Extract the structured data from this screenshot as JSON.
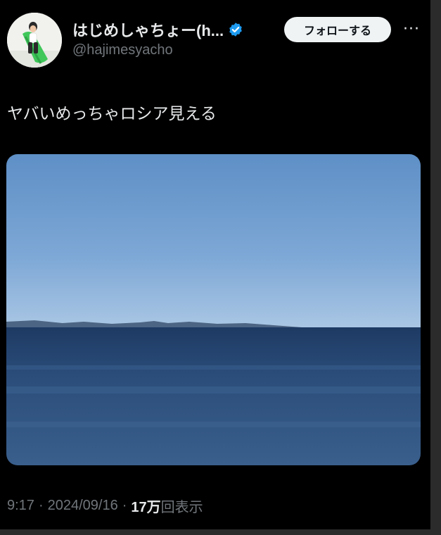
{
  "author": {
    "display_name": "はじめしゃちょー(h...",
    "handle": "@hajimesyacho",
    "verified": true
  },
  "actions": {
    "follow_label": "フォローする",
    "more_label": "···"
  },
  "tweet": {
    "text": "ヤバいめっちゃロシア見える"
  },
  "meta": {
    "time": "9:17",
    "separator": "·",
    "date": "2024/09/16",
    "views_count": "17万",
    "views_label": "回表示"
  },
  "colors": {
    "background": "#000000",
    "text_primary": "#e7e9ea",
    "text_secondary": "#71767b",
    "verified_badge": "#1d9bf0",
    "follow_button_bg": "#eff3f4"
  },
  "icons": {
    "verified": "verified-badge-icon",
    "more": "more-horizontal-icon"
  }
}
